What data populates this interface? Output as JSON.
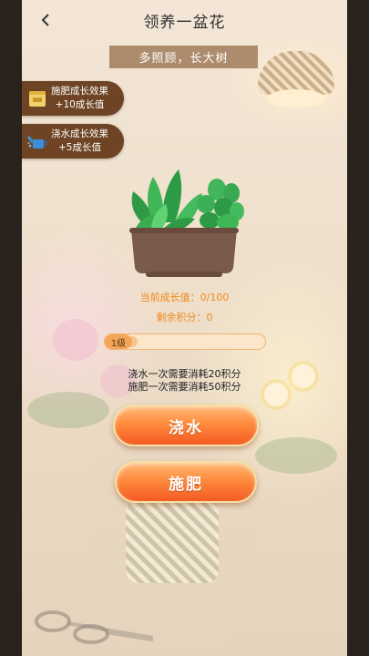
{
  "header": {
    "title": "领养一盆花",
    "back_icon": "chevron-left-icon"
  },
  "subtitle": "多照顾，长大树",
  "effects": [
    {
      "title": "施肥成长效果",
      "value": "+10成长值",
      "icon": "fertilizer-bag-icon"
    },
    {
      "title": "浇水成长效果",
      "value": "+5成长值",
      "icon": "watering-can-icon"
    }
  ],
  "stats": {
    "growth": "当前成长值：0/100",
    "points": "剩余积分：0"
  },
  "level": {
    "label": "1级",
    "progress": 0.05
  },
  "costs": {
    "water": "浇水一次需要消耗20积分",
    "fertilize": "施肥一次需要消耗50积分"
  },
  "buttons": {
    "water": "浇水",
    "fertilize": "施肥"
  },
  "colors": {
    "accent": "#f08a1a",
    "button": "#f45a23",
    "badge": "#6e4424"
  }
}
